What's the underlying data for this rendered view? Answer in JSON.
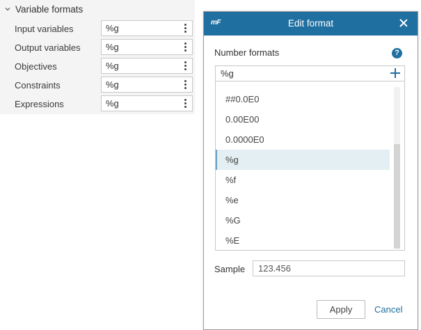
{
  "panel": {
    "section_title": "Variable formats",
    "rows": [
      {
        "label": "Input variables",
        "value": "%g"
      },
      {
        "label": "Output variables",
        "value": "%g"
      },
      {
        "label": "Objectives",
        "value": "%g"
      },
      {
        "label": "Constraints",
        "value": "%g"
      },
      {
        "label": "Expressions",
        "value": "%g"
      }
    ]
  },
  "dialog": {
    "logo": "mF",
    "title": "Edit format",
    "number_formats_label": "Number formats",
    "help_glyph": "?",
    "current_format": "%g",
    "list": [
      "##0.0E0",
      "0.00E00",
      "0.0000E0",
      "%g",
      "%f",
      "%e",
      "%G",
      "%E"
    ],
    "selected_item": "%g",
    "list_scroll_fraction": 0.33,
    "sample_label": "Sample",
    "sample_value": "123.456",
    "apply_label": "Apply",
    "cancel_label": "Cancel"
  },
  "colors": {
    "titlebar": "#1f6fa0",
    "selection": "#e3eff3",
    "accent": "#1f6fa0"
  }
}
